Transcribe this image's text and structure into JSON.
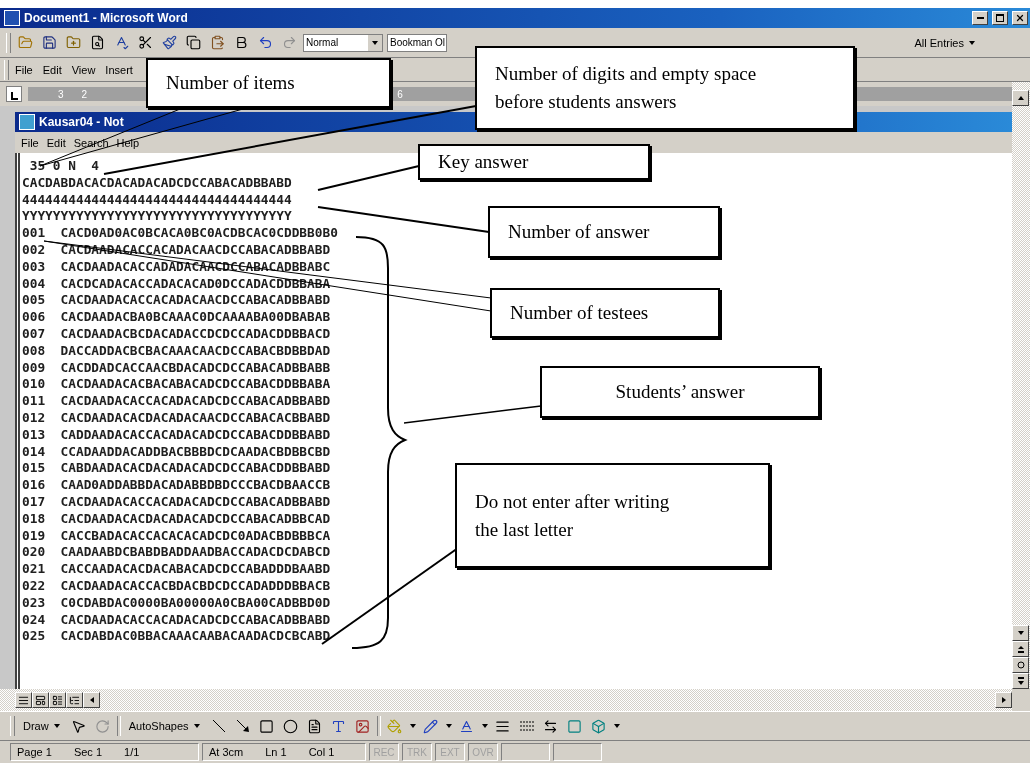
{
  "word_window": {
    "title": "Document1 - Microsoft Word"
  },
  "standard_toolbar": {
    "style": "Normal",
    "font": "Bookman Ol",
    "entries": "All Entries"
  },
  "menu_bar": [
    "File",
    "Edit",
    "View",
    "Insert"
  ],
  "ruler": {
    "labels": [
      "3",
      "2",
      "6"
    ]
  },
  "notepad": {
    "title": "Kausar04 - Not",
    "menu": [
      "File",
      "Edit",
      "Search",
      "Help"
    ],
    "header": " 35 0 N  4",
    "key": "CACDABDACACDACADACADCDCCABACADBBABD",
    "options": "44444444444444444444444444444444444",
    "flags": "YYYYYYYYYYYYYYYYYYYYYYYYYYYYYYYYYYY",
    "students": [
      {
        "number": "001",
        "answers": "CACD0AD0AC0BCACA0BC0ACDBCAC0CDDBB0B0"
      },
      {
        "number": "002",
        "answers": "CACDAADACACCACADACAACDCCABACADBBABD"
      },
      {
        "number": "003",
        "answers": "CACDAADACACCADADACAACDCCABACADBBABC"
      },
      {
        "number": "004",
        "answers": "CACDCADACACCADACACAD0DCCADACDDBBABA"
      },
      {
        "number": "005",
        "answers": "CACDAADACACCACADACAACDCCABACADBBABD"
      },
      {
        "number": "006",
        "answers": "CACDAADACBA0BCAAAC0DCAAAABA00DBABAB"
      },
      {
        "number": "007",
        "answers": "CACDAADACBCDACADACCDCDCCADACDDBBACD"
      },
      {
        "number": "008",
        "answers": "DACCADDACBCBACAAACAACDCCABACBDBBDAD"
      },
      {
        "number": "009",
        "answers": "CACDDADCACCAACBDACADCDCCABACADBBABB"
      },
      {
        "number": "010",
        "answers": "CACDAADACACBACABACADCDCCABACDDBBABA"
      },
      {
        "number": "011",
        "answers": "CACDAADACACCACADACADCDCCABACADBBABD"
      },
      {
        "number": "012",
        "answers": "CACDAADACACDACADACAACDCCABACACBBABD"
      },
      {
        "number": "013",
        "answers": "CADDAADACACCACADACADCDCCABACDDBBABD"
      },
      {
        "number": "014",
        "answers": "CCADAADDACADDBACBBBDCDCAADACBDBBCBD"
      },
      {
        "number": "015",
        "answers": "CABDAADACACDACADACADCDCCABACDDBBABD"
      },
      {
        "number": "016",
        "answers": "CAAD0ADDABBDACADABBDBDCCCBACDBAACCB"
      },
      {
        "number": "017",
        "answers": "CACDAADACACCACADACADCDCCABACADBBABD"
      },
      {
        "number": "018",
        "answers": "CACDAADACACDACADACADCDCCABACADBBCAD"
      },
      {
        "number": "019",
        "answers": "CACCBADACACCACACACADCDC0ADACBDBBBCA"
      },
      {
        "number": "020",
        "answers": "CAADAABDCBABDBADDAADBACCADACDCDABCD"
      },
      {
        "number": "021",
        "answers": "CACCAADACACDACABACADCDCCABADDDBAABD"
      },
      {
        "number": "022",
        "answers": "CACDAADACACCACBDACBDCDCCADADDDBBACB"
      },
      {
        "number": "023",
        "answers": "C0CDABDAC0000BA00000A0CBA00CADBBD0D"
      },
      {
        "number": "024",
        "answers": "CACDAADACACCACADACADCDCCABACADBBABD"
      },
      {
        "number": "025",
        "answers": "CACDABDAC0BBACAAACAABACAADACDCBCABD"
      }
    ]
  },
  "callouts": [
    {
      "lines": [
        "Number of items"
      ]
    },
    {
      "lines": [
        "Number of digits and empty space",
        "before students answers"
      ]
    },
    {
      "lines": [
        "Key answer"
      ]
    },
    {
      "lines": [
        "Number of answer"
      ]
    },
    {
      "lines": [
        "Number of testees"
      ]
    },
    {
      "lines": [
        "Students’ answer"
      ]
    },
    {
      "lines": [
        "Do not enter after writing",
        "the last letter"
      ]
    }
  ],
  "drawing_toolbar": {
    "draw": "Draw",
    "autoshapes": "AutoShapes"
  },
  "status_bar": {
    "page": "Page 1",
    "section": "Sec 1",
    "pages": "1/1",
    "at": "At 3cm",
    "line": "Ln 1",
    "column": "Col 1",
    "modes": [
      {
        "label": "REC",
        "on": false
      },
      {
        "label": "TRK",
        "on": false
      },
      {
        "label": "EXT",
        "on": false
      },
      {
        "label": "OVR",
        "on": false
      }
    ]
  }
}
